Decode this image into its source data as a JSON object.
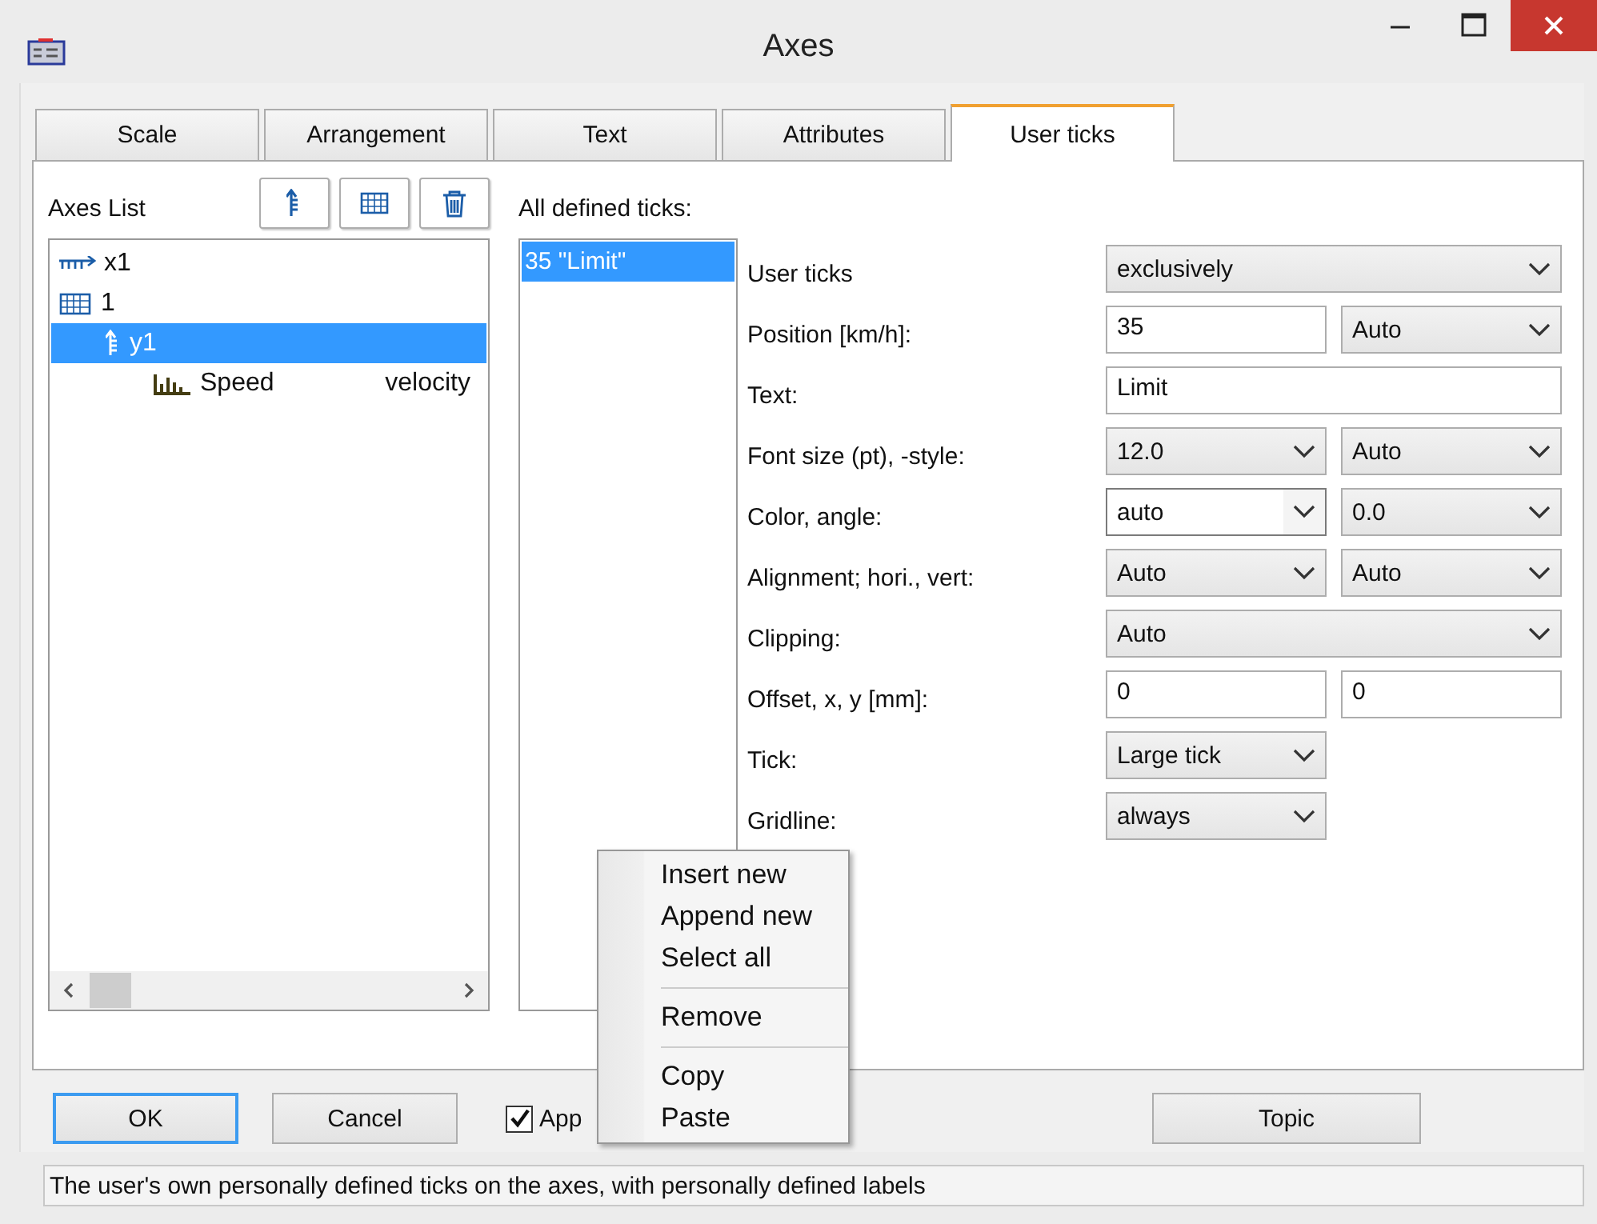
{
  "window": {
    "title": "Axes"
  },
  "tabs": [
    {
      "label": "Scale",
      "selected": false
    },
    {
      "label": "Arrangement",
      "selected": false
    },
    {
      "label": "Text",
      "selected": false
    },
    {
      "label": "Attributes",
      "selected": false
    },
    {
      "label": "User ticks",
      "selected": true
    }
  ],
  "axes_list": {
    "label": "Axes List",
    "items": [
      {
        "kind": "x-axis",
        "label": "x1",
        "selected": false
      },
      {
        "kind": "frame",
        "label": "1",
        "selected": false,
        "children": [
          {
            "kind": "y-axis",
            "label": "y1",
            "selected": true,
            "children": [
              {
                "kind": "channel",
                "label": "Speed",
                "detail": "velocity",
                "selected": false
              }
            ]
          }
        ]
      }
    ]
  },
  "ticks_list": {
    "label": "All defined ticks:",
    "items": [
      {
        "label": "35 \"Limit\"",
        "selected": true
      }
    ]
  },
  "properties": [
    {
      "label": "User ticks",
      "kind": "wide",
      "controls": [
        {
          "kind": "select",
          "value": "exclusively"
        }
      ]
    },
    {
      "label": "Position [km/h]:",
      "kind": "pair",
      "controls": [
        {
          "kind": "input",
          "value": "35"
        },
        {
          "kind": "select",
          "value": "Auto"
        }
      ]
    },
    {
      "label": "Text:",
      "kind": "wide",
      "controls": [
        {
          "kind": "input",
          "value": "Limit"
        }
      ]
    },
    {
      "label": "Font size (pt), -style:",
      "kind": "pair",
      "controls": [
        {
          "kind": "select",
          "value": "12.0"
        },
        {
          "kind": "select",
          "value": "Auto"
        }
      ]
    },
    {
      "label": "Color, angle:",
      "kind": "pair",
      "controls": [
        {
          "kind": "combo",
          "value": "auto"
        },
        {
          "kind": "select",
          "value": "0.0"
        }
      ]
    },
    {
      "label": "Alignment; hori., vert:",
      "kind": "pair",
      "controls": [
        {
          "kind": "select",
          "value": "Auto"
        },
        {
          "kind": "select",
          "value": "Auto"
        }
      ]
    },
    {
      "label": "Clipping:",
      "kind": "wide",
      "controls": [
        {
          "kind": "select",
          "value": "Auto"
        }
      ]
    },
    {
      "label": "Offset, x, y [mm]:",
      "kind": "pair",
      "controls": [
        {
          "kind": "input",
          "value": "0"
        },
        {
          "kind": "input",
          "value": "0"
        }
      ]
    },
    {
      "label": "Tick:",
      "kind": "short",
      "controls": [
        {
          "kind": "select",
          "value": "Large tick"
        }
      ]
    },
    {
      "label": "Gridline:",
      "kind": "short",
      "controls": [
        {
          "kind": "select",
          "value": "always"
        }
      ]
    }
  ],
  "buttons": {
    "ok": "OK",
    "cancel": "Cancel",
    "topic": "Topic"
  },
  "apply_checkbox": {
    "label": "App",
    "checked": true
  },
  "context_menu": [
    {
      "label": "Insert new",
      "separator_before": false
    },
    {
      "label": "Append new",
      "separator_before": false
    },
    {
      "label": "Select all",
      "separator_before": false
    },
    {
      "label": "Remove",
      "separator_before": true
    },
    {
      "label": "Copy",
      "separator_before": true
    },
    {
      "label": "Paste",
      "separator_before": false
    }
  ],
  "status_bar": "The user's own personally defined ticks on the axes, with personally defined labels"
}
